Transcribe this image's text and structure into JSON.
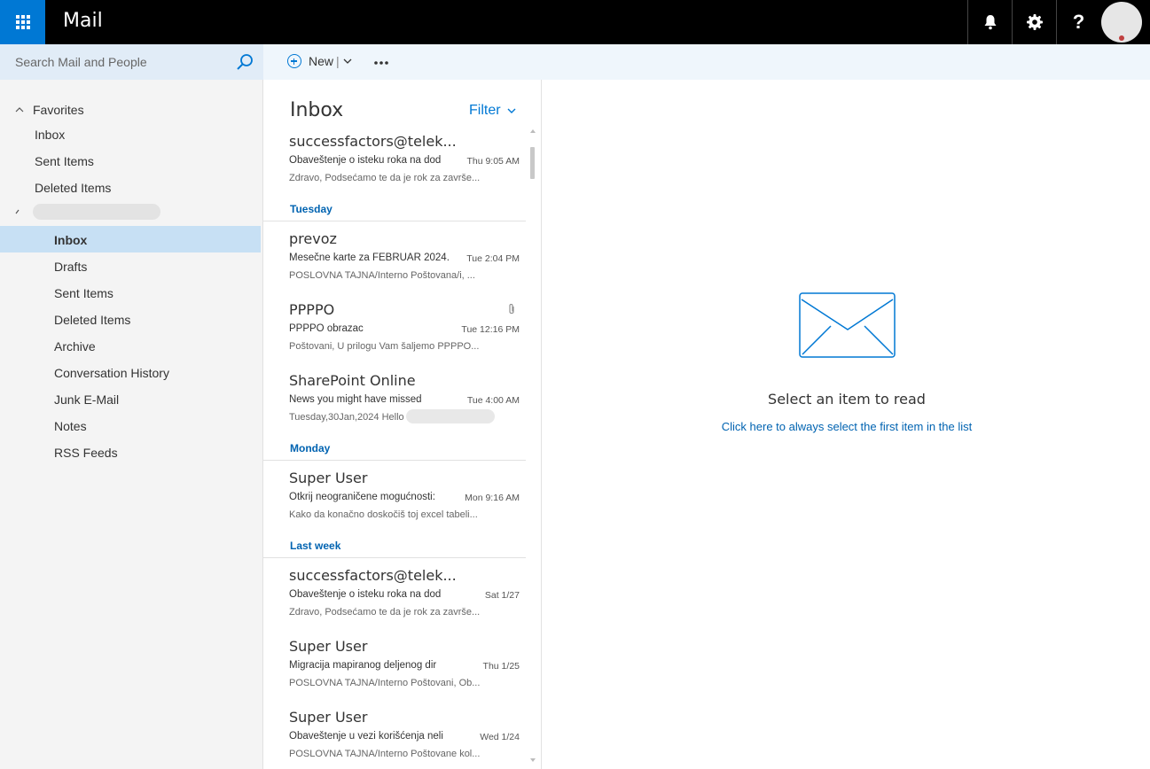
{
  "app": {
    "title": "Mail"
  },
  "search": {
    "placeholder": "Search Mail and People"
  },
  "toolbar": {
    "new_label": "New",
    "sep": "|"
  },
  "nav": {
    "favorites_label": "Favorites",
    "favorites": [
      "Inbox",
      "Sent Items",
      "Deleted Items"
    ],
    "folders": [
      "Inbox",
      "Drafts",
      "Sent Items",
      "Deleted Items",
      "Archive",
      "Conversation History",
      "Junk E-Mail",
      "Notes",
      "RSS Feeds"
    ]
  },
  "list": {
    "title": "Inbox",
    "filter_label": "Filter",
    "groups": [
      "Tuesday",
      "Monday",
      "Last week"
    ],
    "messages": [
      {
        "sender": "successfactors@telek...",
        "subject": "Obaveštenje o isteku roka na dod",
        "time": "Thu 9:05 AM",
        "preview": "Zdravo, Podsećamo te da je rok za završe..."
      },
      {
        "sender": "prevoz",
        "subject": "Mesečne karte za FEBRUAR 2024.",
        "time": "Tue 2:04 PM",
        "preview": "POSLOVNA TAJNA/Interno Poštovana/i, ..."
      },
      {
        "sender": "PPPPO",
        "subject": "PPPPO obrazac",
        "time": "Tue 12:16 PM",
        "preview": "Poštovani, U prilogu Vam šaljemo PPPPO..."
      },
      {
        "sender": "SharePoint Online",
        "subject": "News you might have missed",
        "time": "Tue 4:00 AM",
        "preview": "Tuesday,30Jan,2024 Hello"
      },
      {
        "sender": "Super User",
        "subject": "Otkrij neograničene mogućnosti:",
        "time": "Mon 9:16 AM",
        "preview": "Kako da konačno doskočiš toj excel tabeli..."
      },
      {
        "sender": "successfactors@telek...",
        "subject": "Obaveštenje o isteku roka na dod",
        "time": "Sat 1/27",
        "preview": "Zdravo, Podsećamo te da je rok za završe..."
      },
      {
        "sender": "Super User",
        "subject": "Migracija mapiranog deljenog dir",
        "time": "Thu 1/25",
        "preview": "POSLOVNA TAJNA/Interno Poštovani, Ob..."
      },
      {
        "sender": "Super User",
        "subject": "Obaveštenje u vezi korišćenja neli",
        "time": "Wed 1/24",
        "preview": "POSLOVNA TAJNA/Interno Poštovane kol..."
      }
    ]
  },
  "reading": {
    "empty_title": "Select an item to read",
    "empty_link": "Click here to always select the first item in the list"
  },
  "colors": {
    "accent": "#0078d4",
    "selected": "#c7e0f4",
    "topbar": "#000000"
  }
}
